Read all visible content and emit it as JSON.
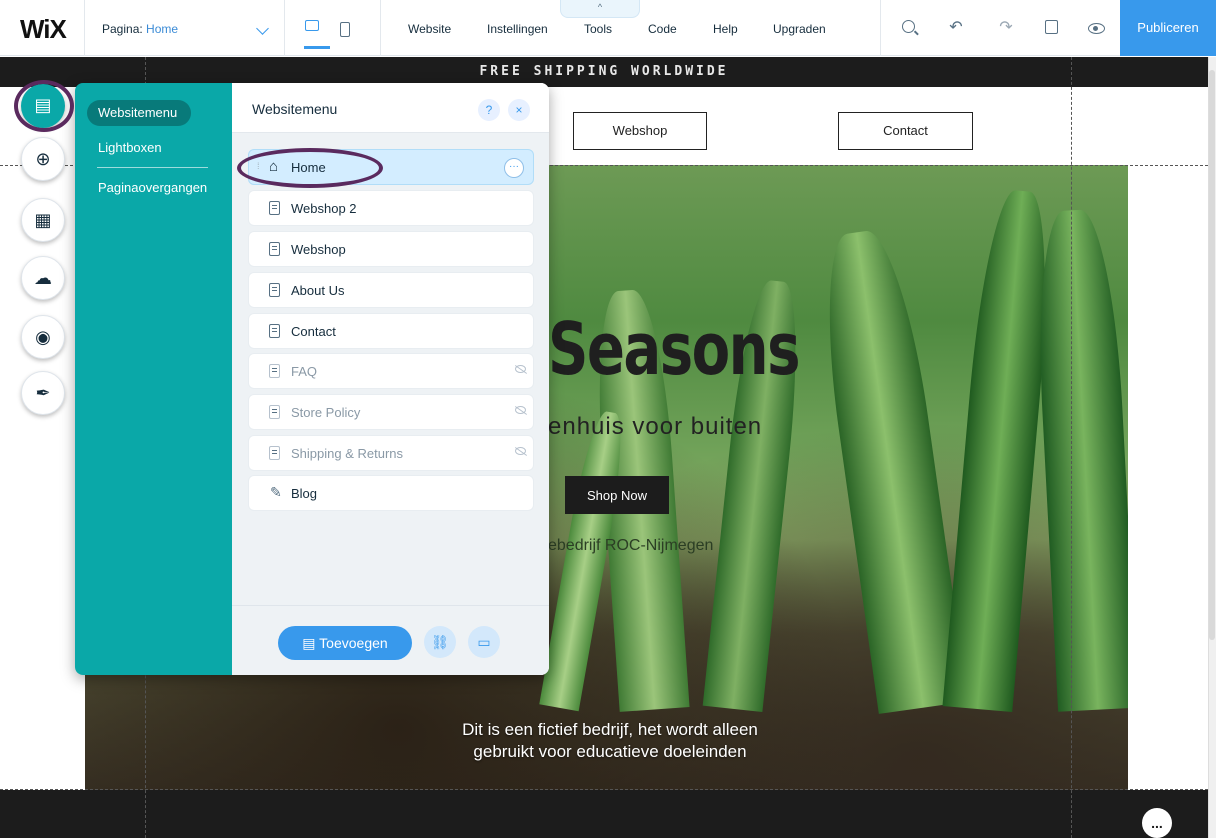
{
  "topbar": {
    "logo": "WiX",
    "page_label": "Pagina:",
    "page_value": "Home",
    "menu": [
      "Website",
      "Instellingen",
      "Tools",
      "Code",
      "Help",
      "Upgraden"
    ],
    "tools_tab": "^",
    "publish": "Publiceren"
  },
  "site": {
    "shipping_banner": "FREE SHIPPING WORLDWIDE",
    "nav": [
      "Webshop",
      "Contact"
    ],
    "hero_title": "Seasons",
    "hero_subtitle": "enhuis voor buiten",
    "shop_button": "Shop Now",
    "hero_small": "ebedrijf ROC-Nijmegen",
    "footer_text_1": "Dit is een fictief bedrijf, het wordt alleen",
    "footer_text_2": "gebruikt voor educatieve doeleinden",
    "chat_icon": "..."
  },
  "rail": {
    "icons": [
      "pages-icon",
      "add-icon",
      "app-market-icon",
      "upload-icon",
      "chat-bubble-icon",
      "pen-icon"
    ]
  },
  "panel": {
    "left_items": [
      "Websitemenu",
      "Lightboxen",
      "Paginaovergangen"
    ],
    "title": "Websitemenu",
    "help": "?",
    "close": "×",
    "pages": [
      {
        "label": "Home",
        "icon": "home-icon",
        "hidden": false,
        "selected": true
      },
      {
        "label": "Webshop 2",
        "icon": "page-icon",
        "hidden": false
      },
      {
        "label": "Webshop",
        "icon": "page-icon",
        "hidden": false
      },
      {
        "label": "About Us",
        "icon": "page-icon",
        "hidden": false
      },
      {
        "label": "Contact",
        "icon": "page-icon",
        "hidden": false
      },
      {
        "label": "FAQ",
        "icon": "page-icon",
        "hidden": true
      },
      {
        "label": "Store Policy",
        "icon": "page-icon",
        "hidden": true
      },
      {
        "label": "Shipping & Returns",
        "icon": "page-icon",
        "hidden": true
      },
      {
        "label": "Blog",
        "icon": "blog-icon",
        "hidden": false
      }
    ],
    "add_button": "Toevoegen",
    "more": "···"
  },
  "colors": {
    "accent": "#3899ec",
    "panel_teal": "#0aa8a8",
    "annotation": "#5a2a5e"
  }
}
